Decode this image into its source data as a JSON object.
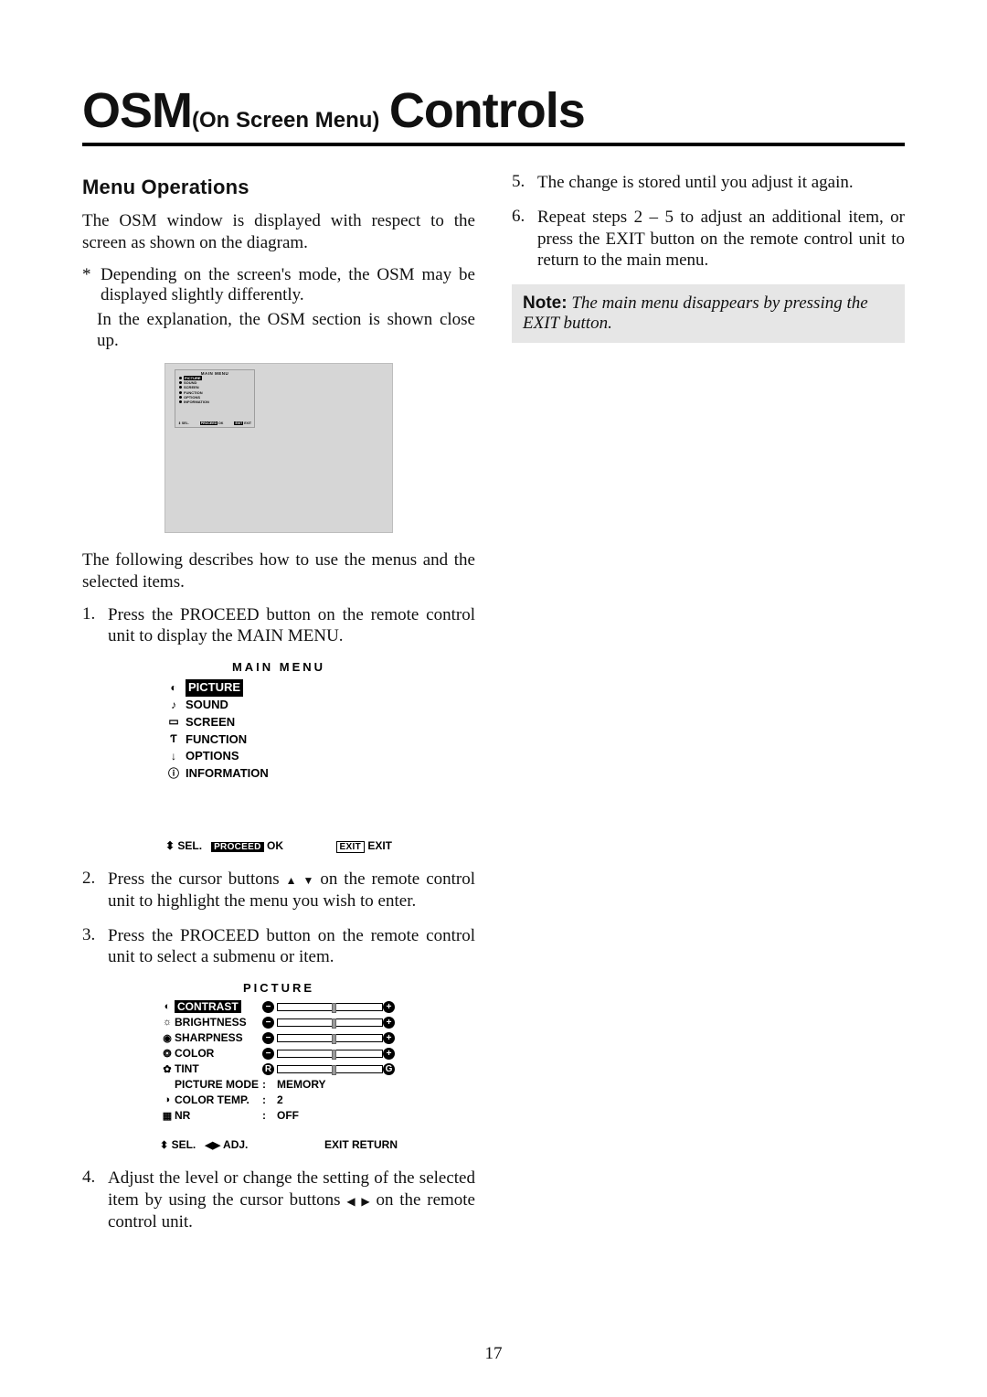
{
  "title": {
    "big1": "OSM",
    "sub": "(On Screen Menu)",
    "big2": "Controls"
  },
  "left": {
    "section_head": "Menu Operations",
    "intro": "The OSM window is displayed with respect to the screen as shown on the diagram.",
    "star_line": "Depending on the screen's mode, the OSM may be displayed slightly differently.",
    "star_follow": "In the explanation, the OSM section is shown close up.",
    "after_diagram": "The following describes how to use the menus and the selected items.",
    "step1": "Press the PROCEED button on the remote control unit to display the MAIN MENU.",
    "step2a": "Press the cursor buttons ",
    "step2b": " on the remote control unit to highlight the menu you wish to enter.",
    "step3": "Press the PROCEED button on the remote control unit to select a submenu or item.",
    "step4a": "Adjust the level or change the setting of the selected item by using the cursor buttons ",
    "step4b": " on the remote control unit."
  },
  "right": {
    "step5": "The change is stored until you adjust it again.",
    "step6": "Repeat steps 2 – 5 to adjust an additional item, or press the EXIT button on the remote control unit to return to the main menu.",
    "note_label": "Note:",
    "note_text": " The main menu disappears by pressing the EXIT button."
  },
  "osm_main": {
    "title": "MAIN MENU",
    "items": [
      {
        "icon": "◐",
        "label": "PICTURE",
        "selected": true
      },
      {
        "icon": "♪",
        "label": "SOUND"
      },
      {
        "icon": "▭",
        "label": "SCREEN"
      },
      {
        "icon": "Ƭ",
        "label": "FUNCTION"
      },
      {
        "icon": "↓",
        "label": "OPTIONS"
      },
      {
        "icon": "ⓘ",
        "label": "INFORMATION"
      }
    ],
    "foot": {
      "sel": "SEL.",
      "proceed": "PROCEED",
      "ok": "OK",
      "exitchip": "EXIT",
      "exit": "EXIT"
    }
  },
  "osm_picture": {
    "title": "PICTURE",
    "rows": [
      {
        "icon": "◐",
        "label": "CONTRAST",
        "selected": true,
        "type": "slider",
        "left": "–",
        "right": "+",
        "pos": 0.55
      },
      {
        "icon": "☼",
        "label": "BRIGHTNESS",
        "type": "slider",
        "left": "–",
        "right": "+",
        "pos": 0.55
      },
      {
        "icon": "◉",
        "label": "SHARPNESS",
        "type": "slider",
        "left": "–",
        "right": "+",
        "pos": 0.55
      },
      {
        "icon": "❂",
        "label": "COLOR",
        "type": "slider",
        "left": "–",
        "right": "+",
        "pos": 0.55
      },
      {
        "icon": "✿",
        "label": "TINT",
        "type": "slider",
        "left": "R",
        "right": "G",
        "pos": 0.55
      },
      {
        "icon": "",
        "label": "PICTURE MODE",
        "type": "value",
        "value": "MEMORY"
      },
      {
        "icon": "◑",
        "label": "COLOR TEMP.",
        "type": "value",
        "value": "2"
      },
      {
        "icon": "▦",
        "label": "NR",
        "type": "value",
        "value": "OFF"
      }
    ],
    "foot": {
      "sel": "SEL.",
      "adj": "ADJ.",
      "exitchip": "EXIT",
      "return": "RETURN"
    }
  },
  "mini": {
    "title": "MAIN MENU",
    "items": [
      "PICTURE",
      "SOUND",
      "SCREEN",
      "FUNCTION",
      "OPTIONS",
      "INFORMATION"
    ],
    "foot": {
      "sel": "SEL.",
      "proceed": "PROCEED",
      "ok": "OK",
      "exitchip": "EXIT",
      "exit": "EXIT"
    }
  },
  "page_number": "17"
}
